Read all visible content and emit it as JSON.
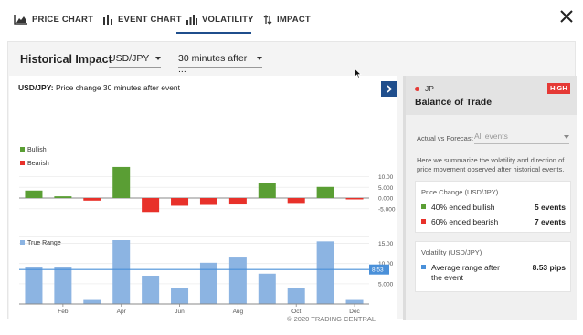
{
  "tabs": [
    {
      "label": "PRICE CHART",
      "icon": "area-chart-icon",
      "active": false
    },
    {
      "label": "EVENT CHART",
      "icon": "bar-chart-icon",
      "active": false
    },
    {
      "label": "VOLATILITY",
      "icon": "volatility-icon",
      "active": true
    },
    {
      "label": "IMPACT",
      "icon": "impact-arrows-icon",
      "active": false
    }
  ],
  "filters": {
    "title": "Historical Impact",
    "pair": "USD/JPY",
    "window": "30 minutes after ..."
  },
  "chart": {
    "title_bold": "USD/JPY:",
    "title_rest": " Price change 30 minutes after event",
    "copyright": "© 2020 TRADING CENTRAL"
  },
  "chart_data": [
    {
      "type": "bar",
      "legend": [
        {
          "name": "Bullish",
          "color": "#5a9e34"
        },
        {
          "name": "Bearish",
          "color": "#e8312a"
        }
      ],
      "values": [
        3.5,
        0.8,
        -1.2,
        14.5,
        -6.5,
        -3.6,
        -3.2,
        -3.0,
        7.0,
        -2.3,
        5.2,
        -0.4
      ],
      "yticks": [
        10,
        5,
        0,
        -5
      ],
      "ytick_labels": [
        "10.00",
        "5.000",
        "0.000",
        "-5.000"
      ],
      "ylim": [
        -7,
        15
      ],
      "colors": {
        "up": "#5a9e34",
        "down": "#e8312a"
      }
    },
    {
      "type": "bar",
      "legend": [
        {
          "name": "True Range",
          "color": "#8cb4e2"
        }
      ],
      "values": [
        9.2,
        9.2,
        1.0,
        27.0,
        7.0,
        4.0,
        10.2,
        11.5,
        7.5,
        4.0,
        15.5,
        1.0
      ],
      "average": 8.53,
      "average_label": "8.53",
      "yticks": [
        15,
        10,
        5
      ],
      "ytick_labels": [
        "15.00",
        "10.00",
        "5.000"
      ],
      "ylim": [
        0,
        18
      ],
      "x_tick_labels": [
        "Feb",
        "Apr",
        "Jun",
        "Aug",
        "Oct",
        "Dec"
      ],
      "colors": {
        "bar": "#8cb4e2",
        "avg": "#4a90d9"
      }
    }
  ],
  "side": {
    "country": "JP",
    "badge": "HIGH",
    "event": "Balance of Trade",
    "avf_label": "Actual vs Forecast",
    "avf_value": "All events",
    "summary": "Here we summarize the volatility and direction of price movement observed after historical events.",
    "price_change": {
      "title": "Price Change (USD/JPY)",
      "bullish_label": "40% ended bullish",
      "bullish_value": "5 events",
      "bearish_label": "60% ended bearish",
      "bearish_value": "7 events"
    },
    "volatility": {
      "title": "Volatility (USD/JPY)",
      "avg_label_1": "Average range after",
      "avg_label_2": "the event",
      "avg_value": "8.53 pips"
    }
  },
  "colors": {
    "accent": "#1f4e8c",
    "high": "#e53935",
    "bullish": "#5a9e34",
    "bearish": "#e8312a",
    "range": "#4a90d9"
  }
}
